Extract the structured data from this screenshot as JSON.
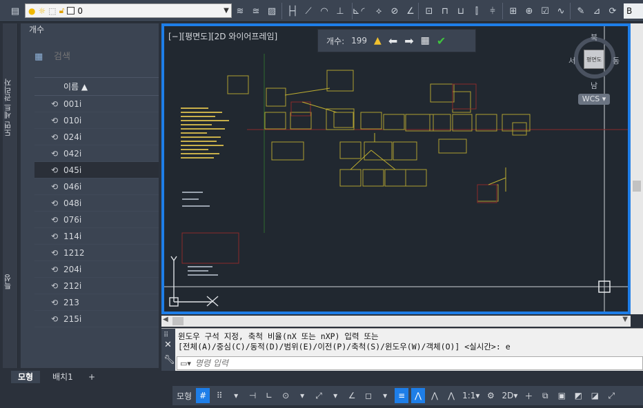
{
  "ribbon": {
    "layer_value": "0",
    "end_label": "B"
  },
  "vertical_tabs": {
    "sheet_set_manager": "도면 세트 관리자",
    "properties": "특성"
  },
  "palette": {
    "title": "개수",
    "search_placeholder": "검색",
    "column_header": "이름 ▲",
    "items": [
      "001i",
      "010i",
      "024i",
      "042i",
      "045i",
      "046i",
      "048i",
      "076i",
      "114i",
      "1212",
      "204i",
      "212i",
      "213",
      "215i"
    ],
    "selected_index": 4
  },
  "viewport": {
    "label": "[−][평면도][2D 와이어프레임]",
    "count_label": "개수:",
    "count_value": "199",
    "viewcube": {
      "north": "북",
      "south": "남",
      "east": "동",
      "west": "서",
      "face": "평면도",
      "wcs": "WCS"
    }
  },
  "command": {
    "line1": "윈도우 구석 지정, 축척 비율(nX 또는 nXP) 입력 또는",
    "line2": "[전체(A)/중심(C)/동적(D)/범위(E)/이전(P)/축척(S)/윈도우(W)/객체(O)] <실시간>: e",
    "input_placeholder": "명령 입력"
  },
  "layout_tabs": [
    "모형",
    "배치1",
    "+"
  ],
  "statusbar": {
    "model_label": "모형",
    "scale_label": "1:1",
    "mode_2d": "2D"
  },
  "colors": {
    "accent": "#1e7ee8",
    "ok_green": "#3ec43e",
    "warn_yellow": "#f2c12e"
  }
}
